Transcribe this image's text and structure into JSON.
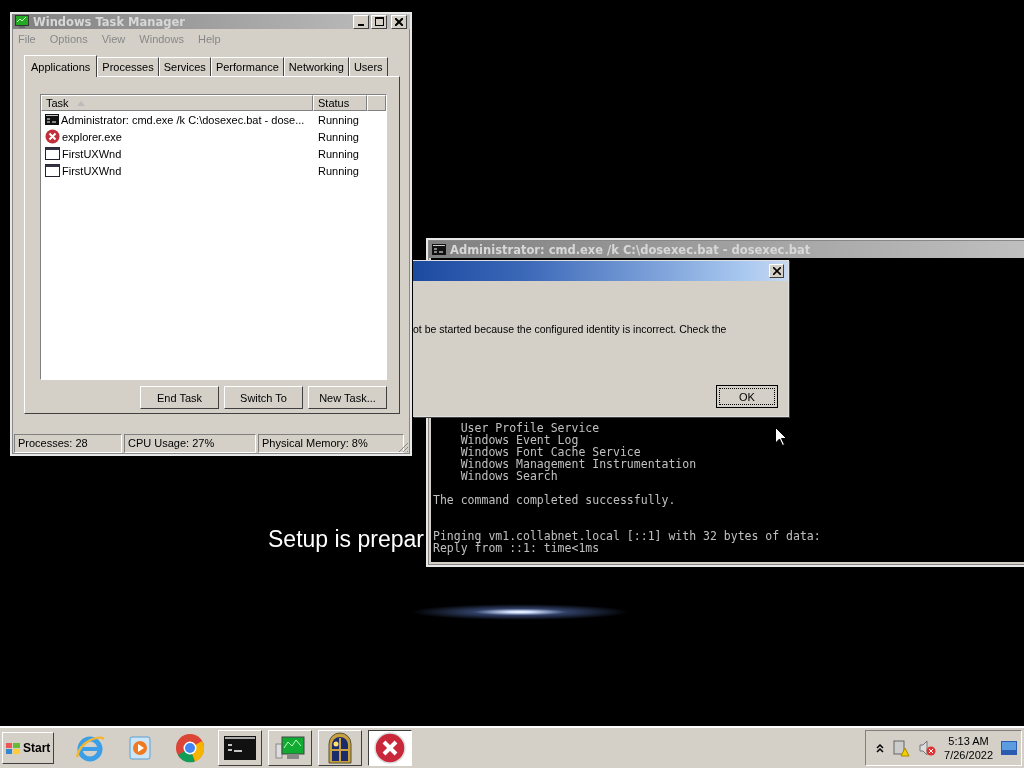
{
  "task_manager": {
    "title": "Windows Task Manager",
    "menu": [
      "File",
      "Options",
      "View",
      "Windows",
      "Help"
    ],
    "tabs": [
      {
        "label": "Applications",
        "selected": true
      },
      {
        "label": "Processes",
        "selected": false
      },
      {
        "label": "Services",
        "selected": false
      },
      {
        "label": "Performance",
        "selected": false
      },
      {
        "label": "Networking",
        "selected": false
      },
      {
        "label": "Users",
        "selected": false
      }
    ],
    "columns": [
      "Task",
      "Status"
    ],
    "rows": [
      {
        "kind": "console",
        "task": "Administrator: cmd.exe /k C:\\dosexec.bat - dose...",
        "status": "Running"
      },
      {
        "kind": "error",
        "task": "explorer.exe",
        "status": "Running"
      },
      {
        "kind": "window",
        "task": "FirstUXWnd",
        "status": "Running"
      },
      {
        "kind": "window",
        "task": "FirstUXWnd",
        "status": "Running"
      }
    ],
    "buttons": [
      "End Task",
      "Switch To",
      "New Task..."
    ],
    "status_bar": [
      "Processes: 28",
      "CPU Usage: 27%",
      "Physical Memory: 8%"
    ]
  },
  "background_text": "Setup is prepar",
  "console": {
    "title": "Administrator: cmd.exe /k C:\\dosexec.bat - dosexec.bat",
    "blocks": [
      [
        "    User Profile Service",
        "    Windows Event Log",
        "    Windows Font Cache Service",
        "    Windows Management Instrumentation",
        "    Windows Search"
      ],
      [
        "The command completed successfully."
      ],
      [
        "Pinging vm1.collabnet.local [::1] with 32 bytes of data:",
        "Reply from ::1: time<1ms"
      ]
    ]
  },
  "dialog": {
    "message": "ot be started because the configured identity is incorrect. Check the",
    "button": "OK"
  },
  "taskbar": {
    "start": "Start",
    "apps": [
      {
        "kind": "ie",
        "active": false
      },
      {
        "kind": "media",
        "active": false
      },
      {
        "kind": "chrome",
        "active": false
      },
      {
        "kind": "console",
        "active": false
      },
      {
        "kind": "monitor",
        "active": false
      },
      {
        "kind": "window",
        "active": false
      },
      {
        "kind": "error",
        "active": true
      }
    ],
    "time": "5:13 AM",
    "date": "7/26/2022"
  }
}
